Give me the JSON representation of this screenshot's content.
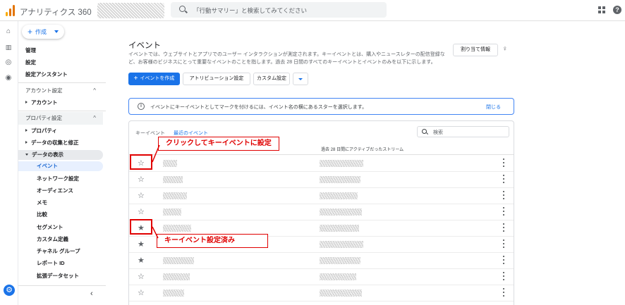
{
  "header": {
    "app_title": "アナリティクス 360",
    "search_placeholder": "「行動サマリー」と検索してみてください"
  },
  "colors": {
    "accent": "#1a73e8",
    "annotation": "#e00000",
    "logo_bars": [
      "#f9ab00",
      "#e37400",
      "#e37400"
    ]
  },
  "nav": {
    "create_label": "作成",
    "top_items": [
      "管理",
      "設定",
      "設定アシスタント"
    ],
    "account_section": "アカウント設定",
    "account_item": "アカウント",
    "property_section": "プロパティ設定",
    "property_items": [
      "プロパティ",
      "データの収集と修正",
      "データの表示"
    ],
    "sub_items": [
      "イベント",
      "ネットワーク設定",
      "オーディエンス",
      "メモ",
      "比較",
      "セグメント",
      "カスタム定義",
      "チャネル グループ",
      "レポート ID",
      "拡張データセット"
    ]
  },
  "main": {
    "title": "イベント",
    "description": "イベントでは、ウェブサイトとアプリでのユーザー インタラクションが測定されます。キーイベントとは、購入やニュースレターの配信登録など、お客様のビジネスにとって重要なイベントのことを指します。過去 28 日間のすべてのキーイベントとイベントのみを以下に示します。",
    "assign_label": "割り当て情報",
    "create_event_label": "イベントを作成",
    "attribution_label": "アトリビューション設定",
    "custom_label": "カスタム設定",
    "info_text": "イベントにキーイベントとしてマークを付けるには、イベント名の横にあるスターを選択します。",
    "info_close": "閉じる",
    "tabs": [
      "キーイベント",
      "最近のイベント"
    ],
    "table_search_placeholder": "検索",
    "column_stream": "過去 28 日間にアクティブだったストリーム",
    "rows": [
      {
        "star": "☆"
      },
      {
        "star": "☆"
      },
      {
        "star": "☆"
      },
      {
        "star": "☆"
      },
      {
        "star": "★"
      },
      {
        "star": "★"
      },
      {
        "star": "★"
      },
      {
        "star": "☆"
      },
      {
        "star": "☆"
      }
    ]
  },
  "annotations": {
    "set_key_event": "クリックしてキーイベントに設定",
    "key_event_set": "キーイベント設定済み"
  }
}
